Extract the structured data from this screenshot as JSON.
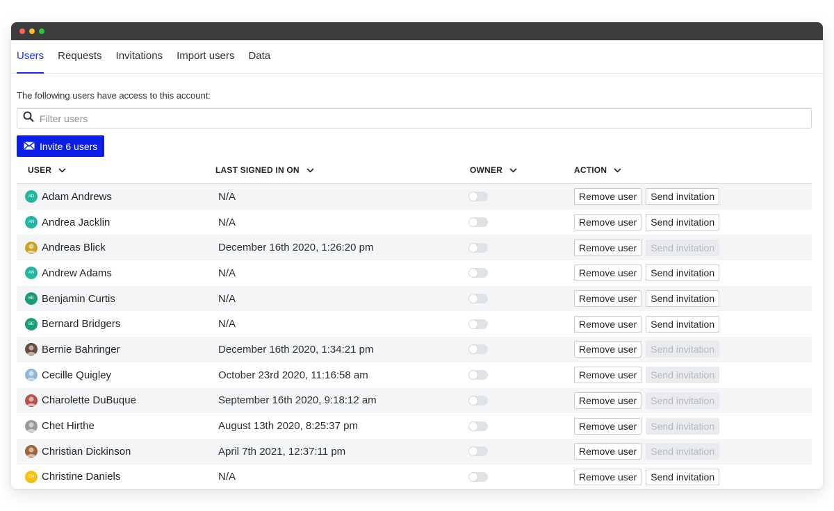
{
  "window": {
    "traffic_lights": [
      "#ff5f57",
      "#febc2e",
      "#28c840"
    ]
  },
  "tabs": [
    {
      "label": "Users",
      "active": true
    },
    {
      "label": "Requests",
      "active": false
    },
    {
      "label": "Invitations",
      "active": false
    },
    {
      "label": "Import users",
      "active": false
    },
    {
      "label": "Data",
      "active": false
    }
  ],
  "intro_text": "The following users have access to this account:",
  "filter": {
    "placeholder": "Filter users",
    "icon": "search-icon"
  },
  "invite_button": {
    "label": "Invite 6 users",
    "icon": "envelope-icon"
  },
  "table": {
    "headers": {
      "user": "USER",
      "last_signed_in": "LAST SIGNED IN ON",
      "owner": "OWNER",
      "action": "ACTION"
    },
    "remove_label": "Remove user",
    "send_label": "Send invitation",
    "rows": [
      {
        "name": "Adam Andrews",
        "last": "N/A",
        "owner": false,
        "invite_enabled": true,
        "avatar": {
          "type": "initials",
          "text": "AD",
          "color": "#26b5a1"
        }
      },
      {
        "name": "Andrea Jacklin",
        "last": "N/A",
        "owner": false,
        "invite_enabled": true,
        "avatar": {
          "type": "initials",
          "text": "AN",
          "color": "#26b5a1"
        }
      },
      {
        "name": "Andreas Blick",
        "last": "December 16th 2020, 1:26:20 pm",
        "owner": false,
        "invite_enabled": false,
        "avatar": {
          "type": "photo",
          "text": "",
          "color": "#c9a227"
        }
      },
      {
        "name": "Andrew Adams",
        "last": "N/A",
        "owner": false,
        "invite_enabled": true,
        "avatar": {
          "type": "initials",
          "text": "AN",
          "color": "#26b5a1"
        }
      },
      {
        "name": "Benjamin Curtis",
        "last": "N/A",
        "owner": false,
        "invite_enabled": true,
        "avatar": {
          "type": "initials",
          "text": "BE",
          "color": "#1a9c7a"
        }
      },
      {
        "name": "Bernard Bridgers",
        "last": "N/A",
        "owner": false,
        "invite_enabled": true,
        "avatar": {
          "type": "initials",
          "text": "BE",
          "color": "#1a9c7a"
        }
      },
      {
        "name": "Bernie Bahringer",
        "last": "December 16th 2020, 1:34:21 pm",
        "owner": false,
        "invite_enabled": false,
        "avatar": {
          "type": "photo",
          "text": "",
          "color": "#6b4b3e"
        }
      },
      {
        "name": "Cecille Quigley",
        "last": "October 23rd 2020, 11:16:58 am",
        "owner": false,
        "invite_enabled": false,
        "avatar": {
          "type": "photo",
          "text": "",
          "color": "#8fb8d8"
        }
      },
      {
        "name": "Charolette DuBuque",
        "last": "September 16th 2020, 9:18:12 am",
        "owner": false,
        "invite_enabled": false,
        "avatar": {
          "type": "photo",
          "text": "",
          "color": "#b0554a"
        }
      },
      {
        "name": "Chet Hirthe",
        "last": "August 13th 2020, 8:25:37 pm",
        "owner": false,
        "invite_enabled": false,
        "avatar": {
          "type": "photo",
          "text": "",
          "color": "#9a9a9a"
        }
      },
      {
        "name": "Christian Dickinson",
        "last": "April 7th 2021, 12:37:11 pm",
        "owner": false,
        "invite_enabled": false,
        "avatar": {
          "type": "photo",
          "text": "",
          "color": "#a0643a"
        }
      },
      {
        "name": "Christine Daniels",
        "last": "N/A",
        "owner": false,
        "invite_enabled": true,
        "avatar": {
          "type": "initials",
          "text": "CH",
          "color": "#f2c21b"
        }
      }
    ]
  },
  "colors": {
    "accent": "#1a2ee0",
    "invite_button_bg": "#0d1fe6"
  }
}
